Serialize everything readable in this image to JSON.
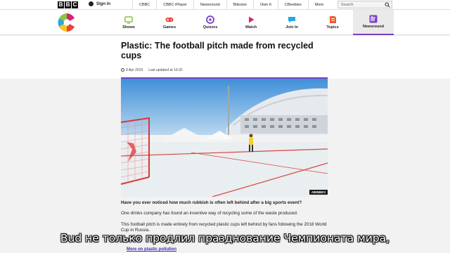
{
  "bbc_bar": {
    "logo_letters": [
      "B",
      "B",
      "C"
    ],
    "signin_label": "Sign in",
    "links": [
      "CBBC",
      "CBBC iPlayer",
      "Newsround",
      "Bitesize",
      "Own It",
      "CBeebies",
      "More"
    ],
    "search_placeholder": "Search"
  },
  "cbbc_nav": {
    "items": [
      {
        "label": "Shows",
        "icon": "tv-icon",
        "color": "#8cc63f"
      },
      {
        "label": "Games",
        "icon": "gamepad-icon",
        "color": "#e8453c"
      },
      {
        "label": "Quizzes",
        "icon": "quiz-icon",
        "color": "#7a3fc6"
      },
      {
        "label": "Watch",
        "icon": "play-icon",
        "color": "#d6247a"
      },
      {
        "label": "Join In",
        "icon": "join-in-icon",
        "color": "#28a8e0"
      },
      {
        "label": "Topics",
        "icon": "topics-icon",
        "color": "#f15a24"
      },
      {
        "label": "Newsround",
        "icon": "newsround-icon",
        "color": "#7a3fc6"
      }
    ],
    "active": "Newsround"
  },
  "article": {
    "headline": "Plastic: The football pitch made from recycled cups",
    "date": "9 Apr 2019",
    "updated": "Last updated at 16:32",
    "photo_credit": "ABINBEV",
    "paragraphs": [
      "Have you ever noticed how much rubbish is often left behind after a big sports event?",
      "One drinks company has found an inventive way of recycling some of the waste produced.",
      "This football pitch is made entirely from recycled plastic cups left behind by fans following the 2018 World Cup in Russia."
    ],
    "more_link": "More on plastic pollution"
  },
  "subtitle": "Bud не только продлил празднование Чемпионата мира,",
  "colors": {
    "accent": "#7a3fc6",
    "cbbc_green": "#8cc63f"
  }
}
